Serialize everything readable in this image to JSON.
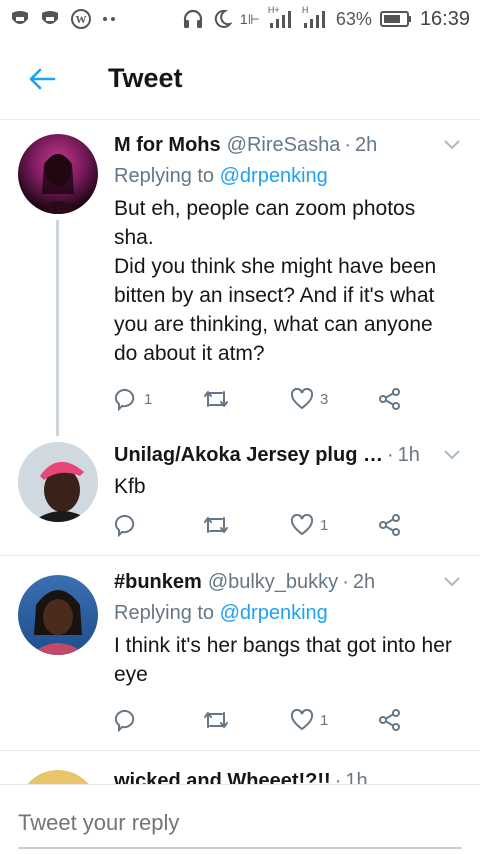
{
  "status_bar": {
    "network_labels": [
      "1⊩",
      "H+",
      "H"
    ],
    "battery": "63%",
    "time": "16:39"
  },
  "header": {
    "title": "Tweet"
  },
  "tweets": [
    {
      "name": "M for Mohs",
      "handle": "@RireSasha",
      "time": "2h",
      "replying_prefix": "Replying to",
      "replying_mention": "@drpenking",
      "lines": [
        "But eh, people can zoom photos",
        "sha.",
        "Did you think she might have been",
        "bitten by an insect? And if it's what",
        "you are thinking, what can anyone",
        "do about it atm?"
      ],
      "reply_count": "1",
      "retweet_count": "",
      "like_count": "3"
    },
    {
      "name": "Unilag/Akoka Jersey plug …",
      "handle": "",
      "time": "1h",
      "lines": [
        "Kfb"
      ],
      "reply_count": "",
      "retweet_count": "",
      "like_count": "1"
    },
    {
      "name": "#bunkem",
      "handle": "@bulky_bukky",
      "time": "2h",
      "replying_prefix": "Replying to",
      "replying_mention": "@drpenking",
      "lines": [
        "I think it's her bangs that got into her",
        "eye"
      ],
      "reply_count": "",
      "retweet_count": "",
      "like_count": "1"
    },
    {
      "name": "wicked and Wheeet!?!!",
      "time": "1h"
    }
  ],
  "reply_bar": {
    "placeholder": "Tweet your reply"
  },
  "colors": {
    "accent": "#1da1f2",
    "secondary_text": "#657786",
    "divider": "#e1e8ed"
  }
}
